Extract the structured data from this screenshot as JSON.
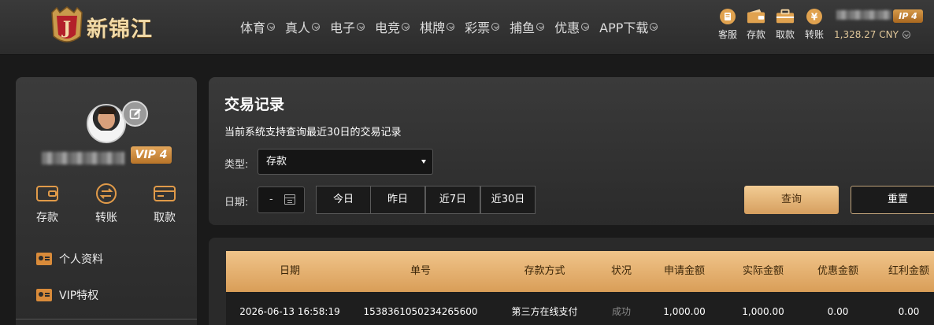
{
  "header": {
    "logo_text": "新锦江",
    "logo_letter": "J",
    "nav": [
      {
        "label": "体育"
      },
      {
        "label": "真人"
      },
      {
        "label": "电子"
      },
      {
        "label": "电竞"
      },
      {
        "label": "棋牌"
      },
      {
        "label": "彩票"
      },
      {
        "label": "捕鱼"
      },
      {
        "label": "优惠"
      },
      {
        "label": "APP下载"
      }
    ],
    "quick_actions": [
      {
        "label": "客服",
        "icon": "chat-icon"
      },
      {
        "label": "存款",
        "icon": "wallet-icon"
      },
      {
        "label": "取款",
        "icon": "bag-icon"
      },
      {
        "label": "转账",
        "icon": "coin-icon"
      }
    ],
    "vip_label": "IP 4",
    "balance": "1,328.27 CNY"
  },
  "sidebar": {
    "vip_label": "VIP 4",
    "actions": [
      {
        "label": "存款",
        "icon": "wallet-icon"
      },
      {
        "label": "转账",
        "icon": "transfer-icon"
      },
      {
        "label": "取款",
        "icon": "card-icon"
      }
    ],
    "menu": [
      {
        "label": "个人资料"
      },
      {
        "label": "VIP特权"
      }
    ]
  },
  "panel": {
    "title": "交易记录",
    "subtitle": "当前系统支持查询最近30日的交易记录",
    "type_label": "类型:",
    "type_value": "存款",
    "date_label": "日期:",
    "date_value": "-",
    "ranges": [
      "今日",
      "昨日",
      "近7日",
      "近30日"
    ],
    "query_label": "查询",
    "reset_label": "重置"
  },
  "table": {
    "columns": [
      "日期",
      "单号",
      "存款方式",
      "状况",
      "申请金额",
      "实际金额",
      "优惠金额",
      "红利金额"
    ],
    "rows": [
      [
        "2026-06-13 16:58:19",
        "1538361050234265600",
        "第三方在线支付",
        "成功",
        "1,000.00",
        "1,000.00",
        "0.00",
        "0.00"
      ]
    ]
  },
  "colors": {
    "accent": "#d99e58",
    "accent_light": "#f0c48a",
    "background": "#1a1a1a"
  }
}
